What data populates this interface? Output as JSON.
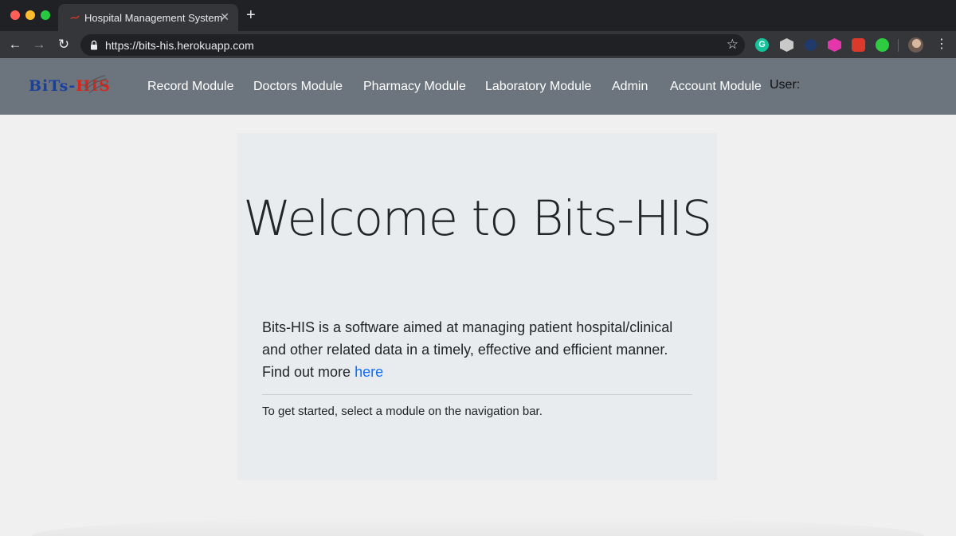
{
  "browser": {
    "tab_title": "Hospital Management System",
    "url": "https://bits-his.herokuapp.com"
  },
  "navbar": {
    "brand": {
      "part1": "BiTs-",
      "part2": "HIS"
    },
    "items": [
      {
        "label": "Record Module"
      },
      {
        "label": "Doctors Module"
      },
      {
        "label": "Pharmacy Module"
      },
      {
        "label": "Laboratory Module"
      },
      {
        "label": "Admin"
      },
      {
        "label": "Account Module"
      }
    ],
    "user_label": "User:"
  },
  "hero": {
    "title": "Welcome to Bits-HIS",
    "lead_text": "Bits-HIS is a software aimed at managing patient hospital/clinical and other related data in a timely, effective and efficient manner. Find out more",
    "link_text": "here",
    "hint": "To get started, select a module on the navigation bar."
  },
  "colors": {
    "navbar_bg": "#6c757d",
    "jumbotron_bg": "#e9ecef",
    "link": "#0d6efd"
  }
}
